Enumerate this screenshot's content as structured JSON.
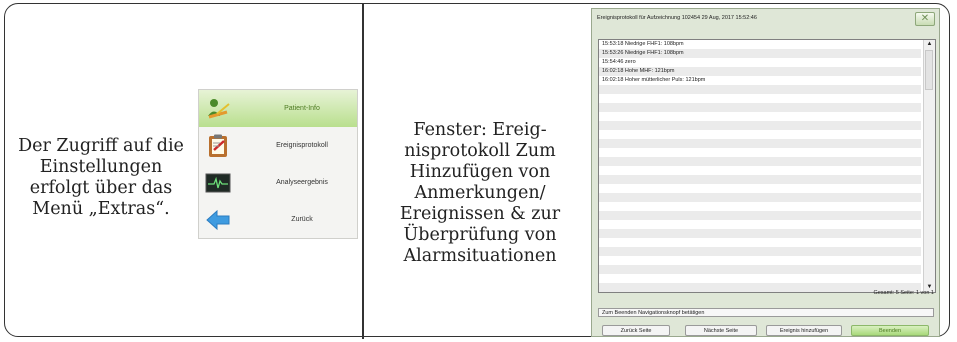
{
  "left_caption": "Der Zugriff auf die Einstellungen erfolgt über das Menü „Extras“.",
  "menu": {
    "items": [
      {
        "label": "Patient-Info",
        "icon": "patient-info-icon",
        "active": true
      },
      {
        "label": "Ereignisprotokoll",
        "icon": "clipboard-icon",
        "active": false
      },
      {
        "label": "Analyseergebnis",
        "icon": "analysis-monitor-icon",
        "active": false
      },
      {
        "label": "Zurück",
        "icon": "back-arrow-icon",
        "active": false
      }
    ]
  },
  "middle_caption": "Fenster: Ereig-nisprotokoll Zum Hinzufügen von Anmerkungen/ Ereignissen & zur Überprüfung von Alarmsituationen",
  "window": {
    "title": "Ereignisprotokoll für Aufzeichnung 102454   29 Aug, 2017 15:52:46",
    "close_label": "✕",
    "events": [
      "15:53:18 Niedrige FHF1: 108bpm",
      "15:53:26 Niedrige FHF1: 108bpm",
      "15:54:46 zero",
      "16:02:18 Hohe MHF: 121bpm",
      "16:02:18 Hoher mütterlicher Puls: 121bpm"
    ],
    "summary": "Gesamt: 5 Seite: 1 von 1",
    "status": "Zum Beenden Navigationsknopf betätigen",
    "buttons": {
      "prev": "Zurück Seite",
      "next": "Nächste Seite",
      "add": "Ereignis hinzufügen",
      "quit": "Beenden"
    },
    "colors": {
      "accent_green": "#a9d97b",
      "title_bar": "#dfe7d7"
    }
  }
}
